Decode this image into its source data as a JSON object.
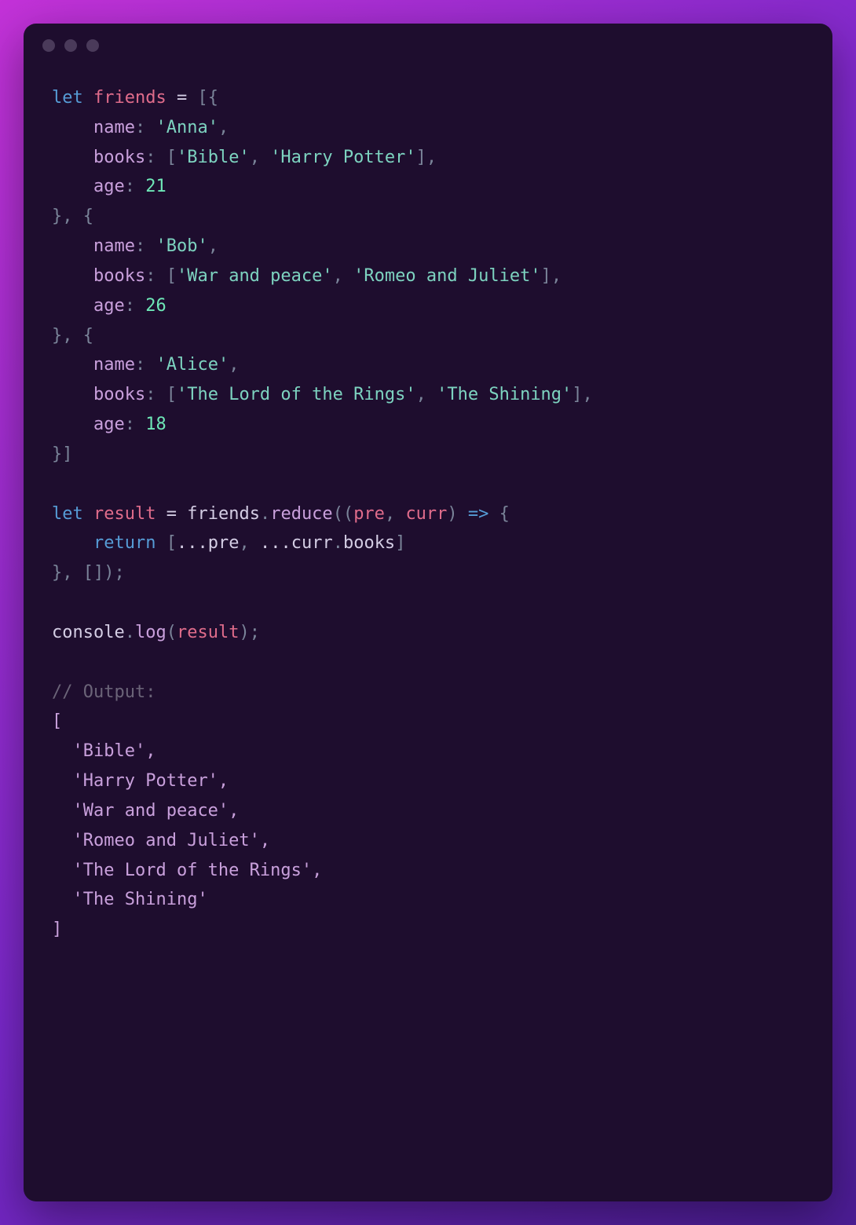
{
  "code": {
    "friends": [
      {
        "name": "Anna",
        "books": [
          "Bible",
          "Harry Potter"
        ],
        "age": 21
      },
      {
        "name": "Bob",
        "books": [
          "War and peace",
          "Romeo and Juliet"
        ],
        "age": 26
      },
      {
        "name": "Alice",
        "books": [
          "The Lord of the Rings",
          "The Shining"
        ],
        "age": 18
      }
    ],
    "tokens": {
      "let": "let",
      "friends_var": "friends",
      "equals": " = ",
      "lbracket_lbrace": "[{",
      "name_prop": "name",
      "colon": ": ",
      "anna": "'Anna'",
      "comma": ",",
      "books_prop": "books",
      "lbracket": "[",
      "bible": "'Bible'",
      "comma_sp": ", ",
      "harry": "'Harry Potter'",
      "rbracket": "]",
      "age_prop": "age",
      "age21": "21",
      "rbrace_comma_lbrace": "}, {",
      "bob": "'Bob'",
      "war": "'War and peace'",
      "romeo": "'Romeo and Juliet'",
      "age26": "26",
      "alice": "'Alice'",
      "lotr": "'The Lord of the Rings'",
      "shining": "'The Shining'",
      "age18": "18",
      "rbrace_rbracket": "}]",
      "result_var": "result",
      "friends_ref": "friends",
      "dot": ".",
      "reduce": "reduce",
      "lparen": "(",
      "lparen2": "((",
      "pre_param": "pre",
      "curr_param": "curr",
      "rparen": ")",
      "arrow": " => ",
      "lbrace": "{",
      "return": "return",
      "spread": "...",
      "pre_ref": "pre",
      "curr_ref": "curr",
      "books_ref": "books",
      "rbrace": "}",
      "empty_arr": "[]",
      "rparen_semi": ");",
      "console": "console",
      "log": "log",
      "result_ref": "result",
      "comment_output": "// Output:",
      "out_lbracket": "[",
      "out_bible": "'Bible',",
      "out_harry": "'Harry Potter',",
      "out_war": "'War and peace',",
      "out_romeo": "'Romeo and Juliet',",
      "out_lotr": "'The Lord of the Rings',",
      "out_shining": "'The Shining'",
      "out_rbracket": "]"
    }
  }
}
